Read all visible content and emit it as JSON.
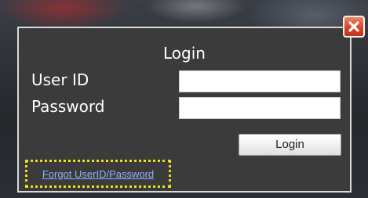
{
  "dialog": {
    "title": "Login",
    "userid_label": "User ID",
    "userid_value": "",
    "password_label": "Password",
    "password_value": "",
    "login_button": "Login",
    "forgot_link": "Forgot UserID/Password",
    "close_icon": "close-icon"
  },
  "colors": {
    "dialog_background": "#3b3b3b",
    "dialog_border": "#d9d9d9",
    "close_button": "#d9442a",
    "highlight_border": "#f1dd18",
    "link": "#8fb1ff"
  }
}
